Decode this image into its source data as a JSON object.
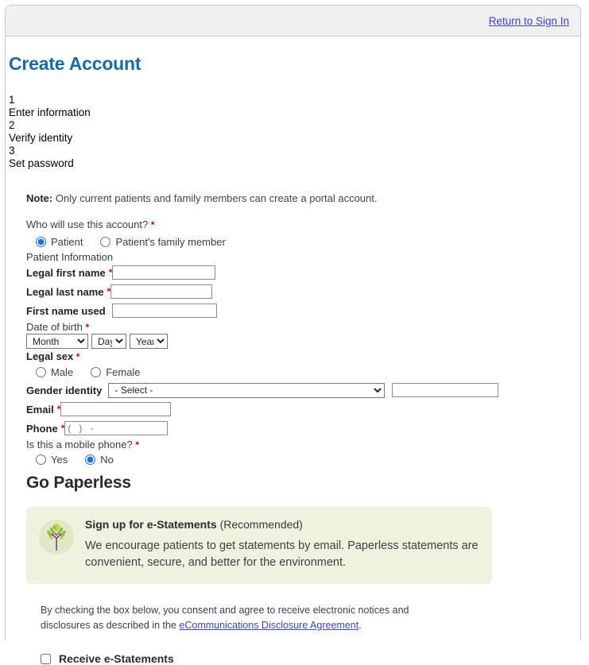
{
  "header": {
    "return_link": "Return to Sign In"
  },
  "page": {
    "title": "Create Account"
  },
  "steps": [
    {
      "number": "1",
      "label": "Enter information"
    },
    {
      "number": "2",
      "label": "Verify identity"
    },
    {
      "number": "3",
      "label": "Set password"
    }
  ],
  "form": {
    "note_prefix": "Note",
    "note_colon": ":",
    "note_text": " Only current patients and family members can create a portal account.",
    "who_question": "Who will use this account?",
    "required_marker": "*",
    "who_options": [
      {
        "label": "Patient",
        "selected": true
      },
      {
        "label": "Patient's family member",
        "selected": false
      }
    ],
    "patient_information_label": "Patient Information",
    "legal_first_name_label": "Legal first name",
    "legal_first_name_value": "",
    "legal_last_name_label": "Legal last name",
    "legal_last_name_value": "",
    "first_name_used_label": "First name used",
    "first_name_used_value": "",
    "dob_label": "Date of birth",
    "dob_month": "Month",
    "dob_day": "Day",
    "dob_year": "Year",
    "legal_sex_label": "Legal sex",
    "legal_sex_options": [
      {
        "label": "Male",
        "selected": false
      },
      {
        "label": "Female",
        "selected": false
      }
    ],
    "gender_identity_label": "Gender identity",
    "gender_identity_value": "- Select -",
    "gender_identity_extra_value": "",
    "email_label": "Email",
    "email_value": "",
    "phone_label": "Phone",
    "phone_placeholder": "(   )   -",
    "mobile_question": "Is this a mobile phone?",
    "mobile_options": [
      {
        "label": "Yes",
        "selected": false
      },
      {
        "label": "No",
        "selected": true
      }
    ]
  },
  "paperless": {
    "title": "Go Paperless",
    "banner_heading_bold": "Sign up for e-Statements",
    "banner_heading_rest": " (Recommended)",
    "banner_body": "We encourage patients to get statements by email. Paperless statements are convenient, secure, and better for the environment.",
    "tree_icon_name": "tree-icon",
    "consent_text_before": "By checking the box below, you consent and agree to receive electronic notices and disclosures as described in the ",
    "consent_link": "eCommunications Disclosure Agreement",
    "consent_text_after": ".",
    "receive_checkbox_label": "Receive e-Statements",
    "receive_checked": false
  },
  "colors": {
    "title_blue": "#136cab",
    "link_blue": "#3b43d6",
    "required_red": "#d0021b",
    "banner_green": "#eef2df",
    "tree_trunk_purple": "#76368f",
    "tree_leaf_green": "#8cbf3f"
  }
}
